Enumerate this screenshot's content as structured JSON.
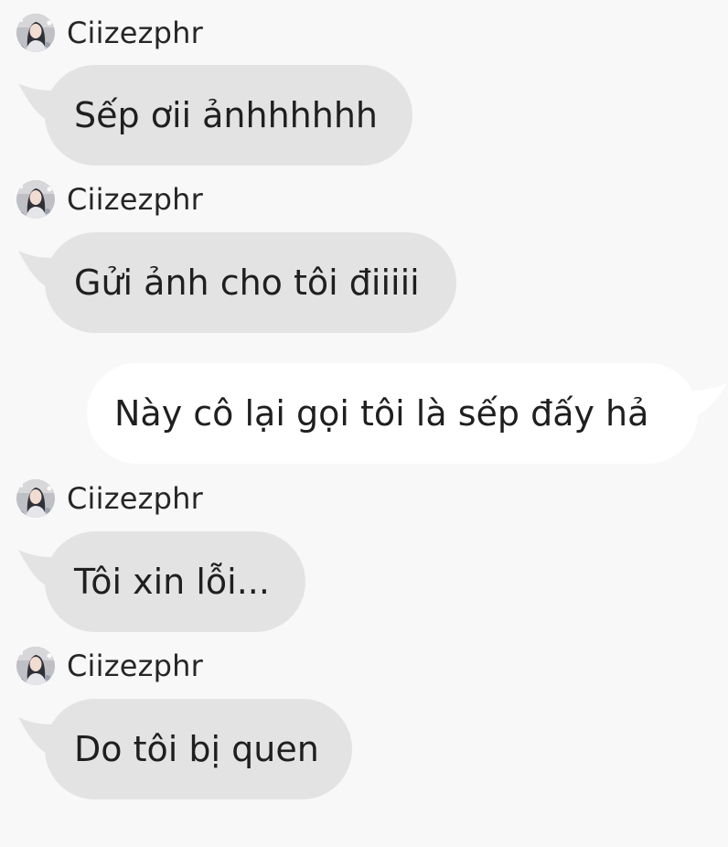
{
  "conversation": {
    "messages": [
      {
        "direction": "incoming",
        "sender": "Ciizezphr",
        "text": "Sếp ơii ảnhhhhhh"
      },
      {
        "direction": "incoming",
        "sender": "Ciizezphr",
        "text": "Gửi ảnh cho tôi điiiii"
      },
      {
        "direction": "outgoing",
        "text": "Này cô lại gọi tôi là sếp đấy hả"
      },
      {
        "direction": "incoming",
        "sender": "Ciizezphr",
        "text": "Tôi xin lỗi..."
      },
      {
        "direction": "incoming",
        "sender": "Ciizezphr",
        "text": "Do tôi bị quen"
      }
    ]
  },
  "colors": {
    "background": "#f8f8f8",
    "incoming_bubble": "#e3e3e4",
    "outgoing_bubble": "#ffffff",
    "text": "#1f1f1f"
  },
  "icons": {
    "avatar": "user-avatar-photo"
  }
}
